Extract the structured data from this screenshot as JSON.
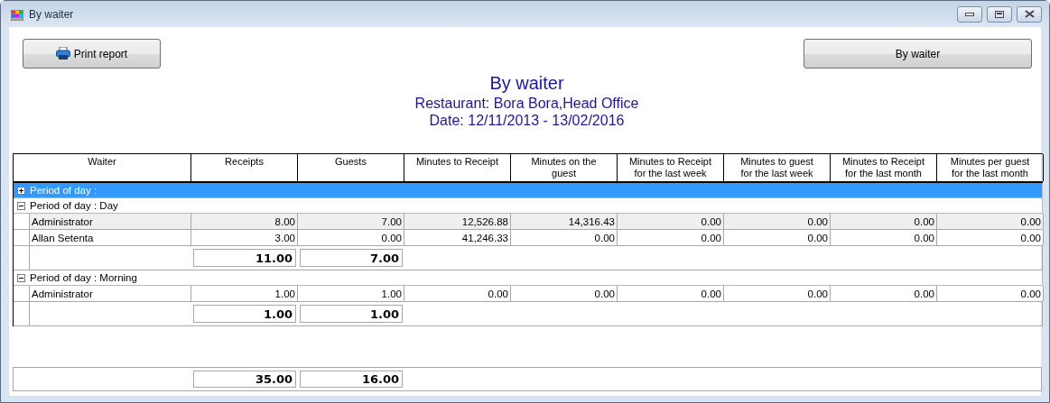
{
  "window": {
    "title": "By waiter"
  },
  "toolbar": {
    "print_button": "Print report",
    "view_button": "By waiter"
  },
  "report": {
    "title": "By waiter",
    "restaurant": "Restaurant: Bora Bora,Head Office",
    "date": "Date: 12/11/2013 - 13/02/2016"
  },
  "table": {
    "columns": [
      "Waiter",
      "Receipts",
      "Guests",
      "Minutes to Receipt",
      "Minutes on the\nguest",
      "Minutes to Receipt\nfor the last week",
      "Minutes to guest\nfor the last week",
      "Minutes to Receipt\nfor the last month",
      "Minutes per guest\nfor the last month"
    ],
    "groups": [
      {
        "label": "Period of day :",
        "expanded": false,
        "selected": true
      },
      {
        "label": "Period of day : Day",
        "expanded": true,
        "selected": false,
        "rows": [
          {
            "selected": true,
            "cells": [
              "Administrator",
              "8.00",
              "7.00",
              "12,526.88",
              "14,316.43",
              "0.00",
              "0.00",
              "0.00",
              "0.00"
            ]
          },
          {
            "selected": false,
            "cells": [
              "Allan Setenta",
              "3.00",
              "0.00",
              "41,246.33",
              "0.00",
              "0.00",
              "0.00",
              "0.00",
              "0.00"
            ]
          }
        ],
        "totals": [
          "11.00",
          "7.00"
        ]
      },
      {
        "label": "Period of day : Morning",
        "expanded": true,
        "selected": false,
        "rows": [
          {
            "selected": false,
            "cells": [
              "Administrator",
              "1.00",
              "1.00",
              "0.00",
              "0.00",
              "0.00",
              "0.00",
              "0.00",
              "0.00"
            ]
          }
        ],
        "totals": [
          "1.00",
          "1.00"
        ]
      }
    ],
    "grand_totals": [
      "35.00",
      "16.00"
    ]
  }
}
